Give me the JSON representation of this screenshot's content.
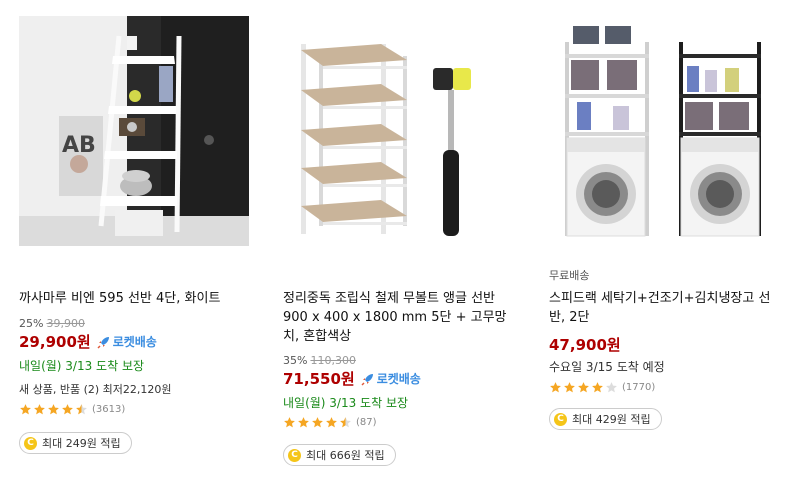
{
  "colors": {
    "price": "#ae0000",
    "rocket": "#3b8de0",
    "arrival_green": "#1a8a1a",
    "star": "#f5a623",
    "coin": "#f5c518"
  },
  "products": [
    {
      "image_icon": "ladder-shelf-photo",
      "free_shipping": "",
      "title": "까사마루 비엔 595 선반 4단, 화이트",
      "discount_pct": "25%",
      "original_price": "39,900",
      "price": "29,900원",
      "rocket_label": "로켓배송",
      "arrival": "내일(월) 3/13 도착 보장",
      "other_sellers": "새 상품, 반품 (2) 최저22,120원",
      "rating": 4.5,
      "review_count": "(3613)",
      "reward": "최대 249원 적립"
    },
    {
      "image_icon": "metal-shelf-hammer-photo",
      "free_shipping": "",
      "title": "정리중독 조립식 철제 무볼트 앵글 선반 900 x 400 x 1800 mm 5단 + 고무망치, 혼합색상",
      "discount_pct": "35%",
      "original_price": "110,300",
      "price": "71,550원",
      "rocket_label": "로켓배송",
      "arrival": "내일(월) 3/13 도착 보장",
      "other_sellers": "",
      "rating": 4.5,
      "review_count": "(87)",
      "reward": "최대 666원 적립"
    },
    {
      "image_icon": "washer-shelf-photo",
      "free_shipping": "무료배송",
      "title": "스피드랙 세탁기+건조기+김치냉장고 선반, 2단",
      "discount_pct": "",
      "original_price": "",
      "price": "47,900원",
      "rocket_label": "",
      "arrival": "수요일 3/15 도착 예정",
      "other_sellers": "",
      "rating": 4.0,
      "review_count": "(1770)",
      "reward": "최대 429원 적립"
    }
  ]
}
